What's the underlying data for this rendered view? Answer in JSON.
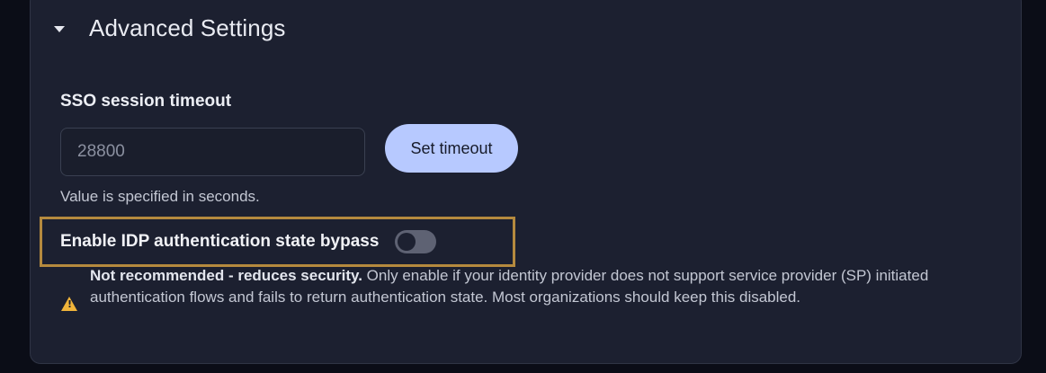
{
  "section": {
    "title": "Advanced Settings"
  },
  "sso_timeout": {
    "label": "SSO session timeout",
    "value": "28800",
    "button_label": "Set timeout",
    "helper": "Value is specified in seconds."
  },
  "idp_bypass": {
    "label": "Enable IDP authentication state bypass",
    "enabled": false
  },
  "warning": {
    "strong": "Not recommended - reduces security.",
    "text": " Only enable if your identity provider does not support service provider (SP) initiated authentication flows and fails to return authentication state. Most organizations should keep this disabled."
  },
  "icons": {
    "collapse": "chevron-down-icon",
    "warning": "warning-triangle-icon"
  },
  "colors": {
    "panel_bg": "#1c2030",
    "button_bg": "#b7c9ff",
    "highlight_border": "#b58a3e",
    "warning": "#f0b43a"
  }
}
